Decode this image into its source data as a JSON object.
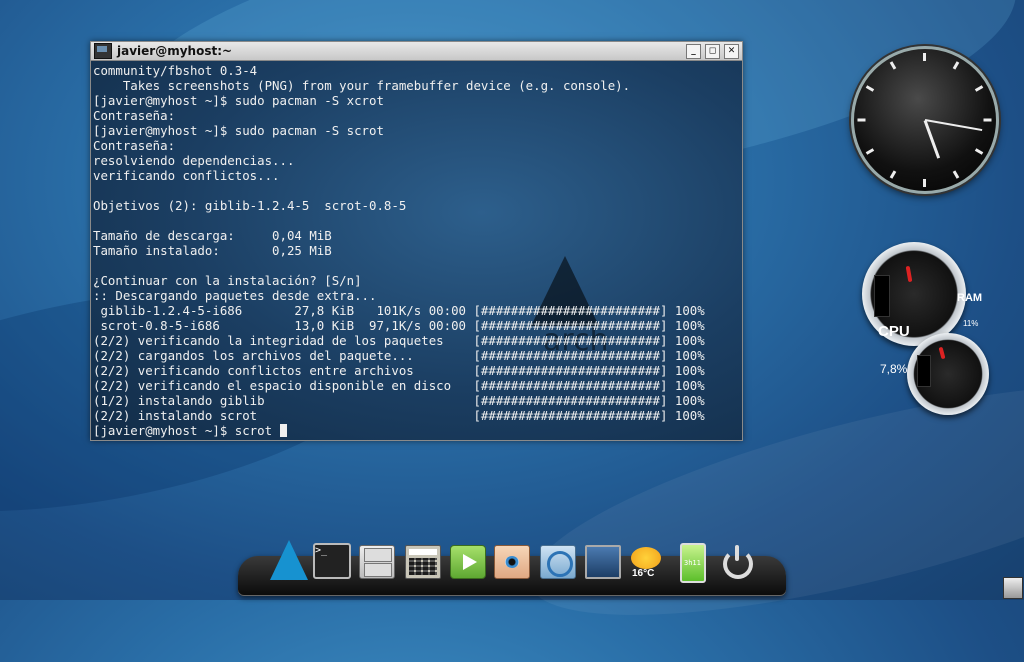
{
  "window": {
    "title": "javier@myhost:~",
    "buttons": [
      "_",
      "◻",
      "✕"
    ]
  },
  "terminal": {
    "lines": [
      "community/fbshot 0.3-4",
      "    Takes screenshots (PNG) from your framebuffer device (e.g. console).",
      "[javier@myhost ~]$ sudo pacman -S xcrot",
      "Contraseña:",
      "[javier@myhost ~]$ sudo pacman -S scrot",
      "Contraseña:",
      "resolviendo dependencias...",
      "verificando conflictos...",
      "",
      "Objetivos (2): giblib-1.2.4-5  scrot-0.8-5",
      "",
      "Tamaño de descarga:     0,04 MiB",
      "Tamaño instalado:       0,25 MiB",
      "",
      "¿Continuar con la instalación? [S/n]",
      ":: Descargando paquetes desde extra...",
      " giblib-1.2.4-5-i686       27,8 KiB   101K/s 00:00 [########################] 100%",
      " scrot-0.8-5-i686          13,0 KiB  97,1K/s 00:00 [########################] 100%",
      "(2/2) verificando la integridad de los paquetes    [########################] 100%",
      "(2/2) cargandos los archivos del paquete...        [########################] 100%",
      "(2/2) verificando conflictos entre archivos        [########################] 100%",
      "(2/2) verificando el espacio disponible en disco   [########################] 100%",
      "(1/2) instalando giblib                            [########################] 100%",
      "(2/2) instalando scrot                             [########################] 100%"
    ],
    "prompt": "[javier@myhost ~]$ scrot ",
    "watermark": "arch"
  },
  "widgets": {
    "cpu_label": "CPU",
    "cpu_value": "7,8%",
    "ram_label": "RAM",
    "ram_value": "11%",
    "clock_hour_deg": 160,
    "clock_minute_deg": 100
  },
  "dock": {
    "terminal_glyph": ">_",
    "weather_temp": "16°C",
    "battery_text": "3h11",
    "icons": [
      "arch-icon",
      "terminal-icon",
      "file-manager-icon",
      "calculator-icon",
      "media-player-icon",
      "image-viewer-icon",
      "browser-icon",
      "screenshot-icon",
      "weather-icon",
      "battery-icon",
      "power-icon"
    ]
  },
  "colors": {
    "desktop": "#2a6fa8",
    "terminal_bg": "#1b3e62",
    "terminal_fg": "#f0f0f0",
    "arch_blue": "#1792d0"
  }
}
